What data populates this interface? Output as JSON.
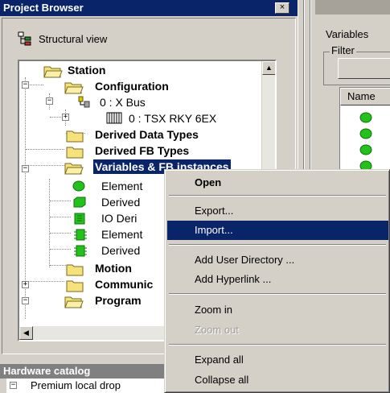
{
  "project_browser": {
    "title": "Project Browser",
    "close_glyph": "×",
    "view_label": "Structural view",
    "view_icon": "structural-view-icon"
  },
  "tree": {
    "station": "Station",
    "configuration": "Configuration",
    "xbus": "0 : X Bus",
    "rack": "0 : TSX RKY 6EX",
    "derived_data_types": "Derived Data Types",
    "derived_fb_types": "Derived FB Types",
    "variables": "Variables & FB instances",
    "element_vars": "Element",
    "derived_vars": "Derived",
    "io_derived": "IO Deri",
    "element_fb": "Element",
    "derived_fb": "Derived",
    "motion": "Motion",
    "communication": "Communic",
    "program": "Program"
  },
  "context_menu": {
    "items": {
      "open": "Open",
      "export": "Export...",
      "import": "Import...",
      "add_user_directory": "Add User Directory ...",
      "add_hyperlink": "Add Hyperlink ...",
      "zoom_in": "Zoom in",
      "zoom_out": "Zoom out",
      "expand_all": "Expand all",
      "collapse_all": "Collapse all"
    },
    "highlighted": "import",
    "disabled": [
      "zoom_out"
    ]
  },
  "hardware_catalog": {
    "title": "Hardware catalog",
    "item": "Premium local drop"
  },
  "variables_panel": {
    "label": "Variables",
    "filter": "Filter",
    "name_column": "Name"
  },
  "colors": {
    "title_active": "#0a246a",
    "face": "#d4d0c8",
    "folder": "#f5e27a",
    "green": "#22c21a"
  }
}
